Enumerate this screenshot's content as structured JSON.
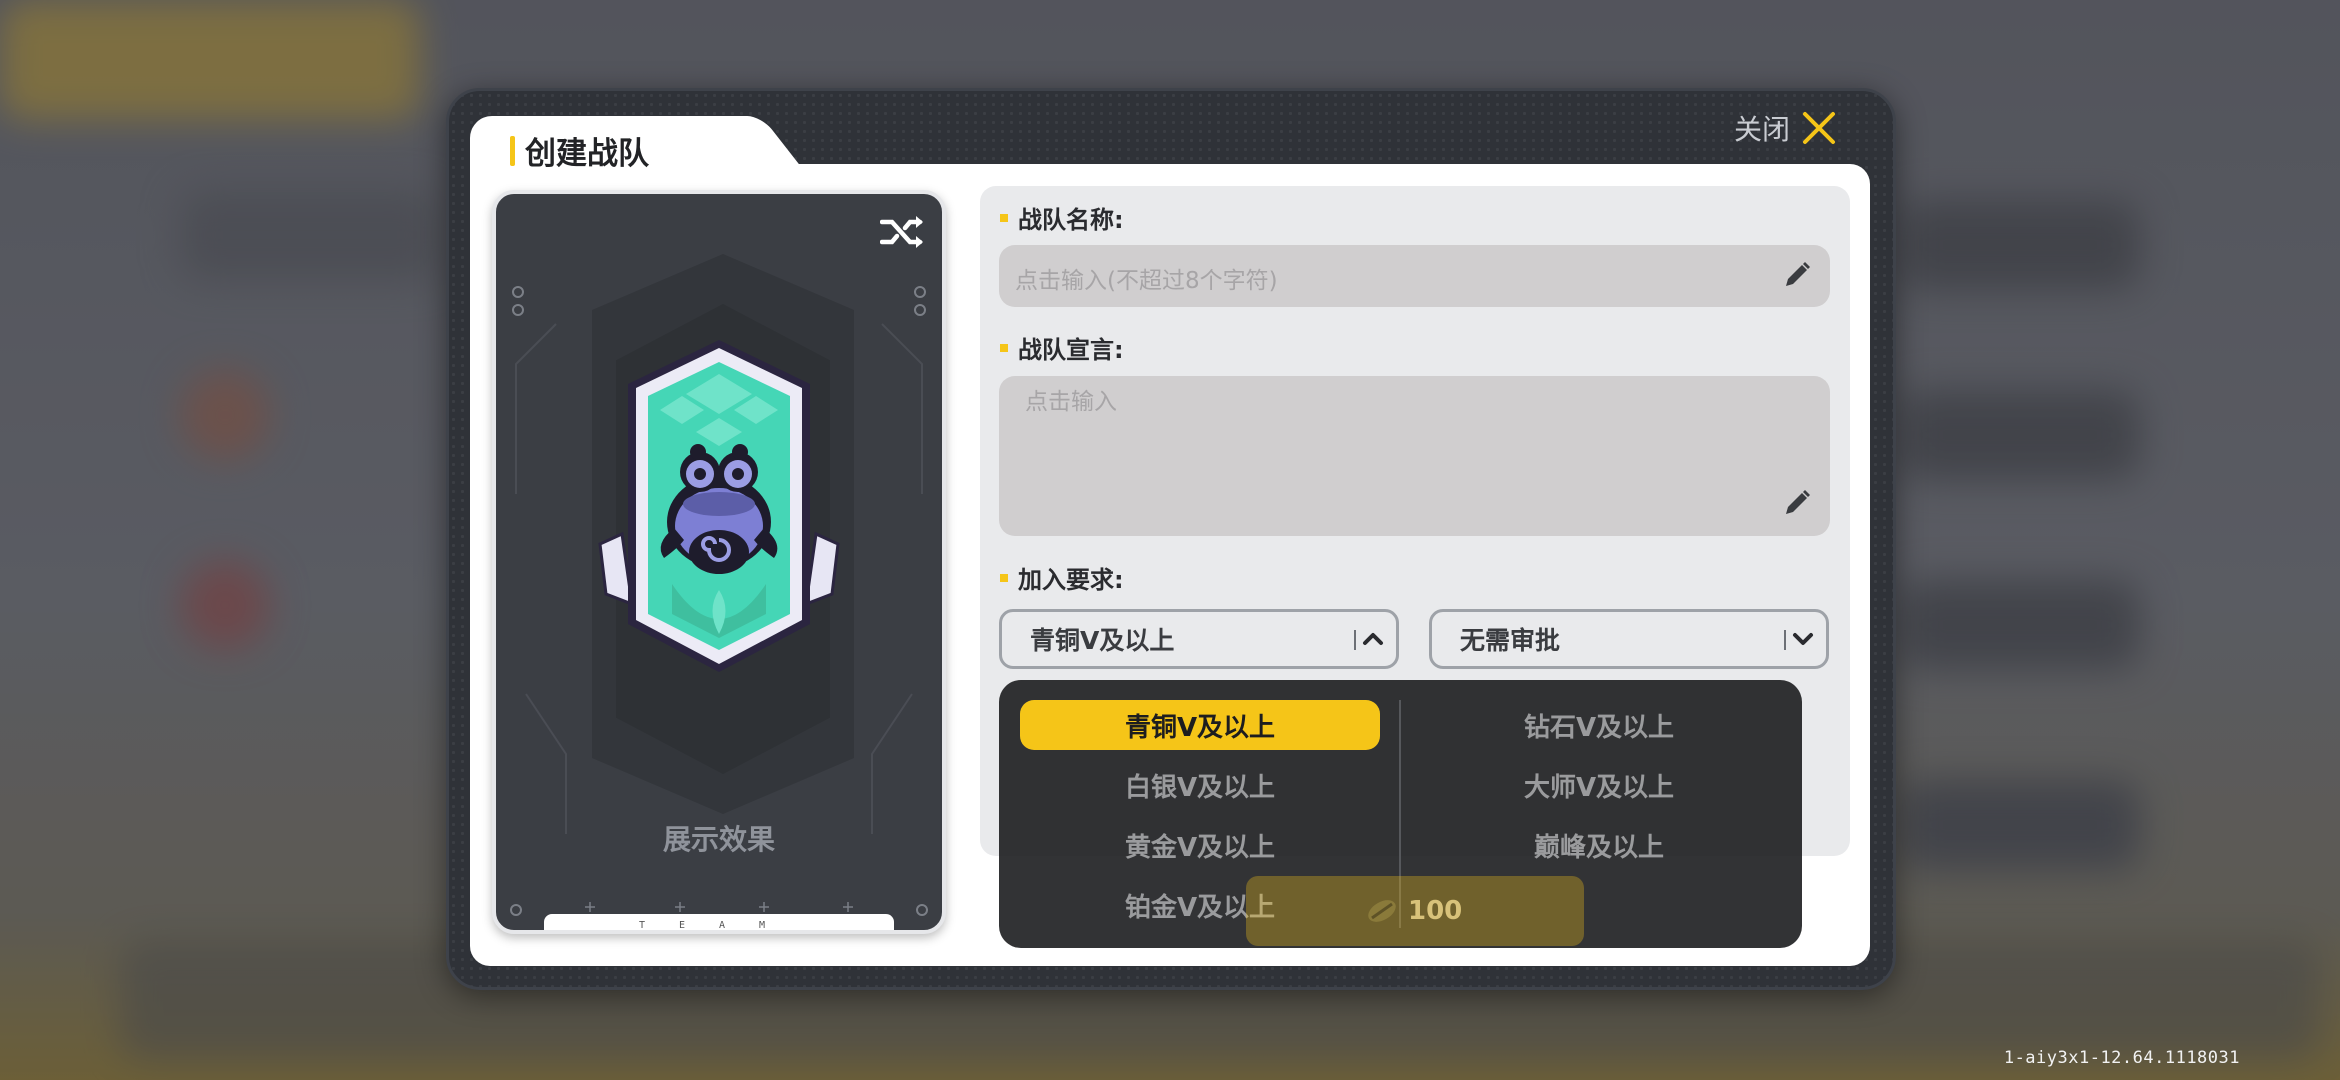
{
  "dialog": {
    "title": "创建战队",
    "close_label": "关闭"
  },
  "preview": {
    "label": "展示效果",
    "footer_text": "TEAM",
    "emblem": {
      "name": "frog-mascot-emblem",
      "colors": {
        "teal": "#45d6b6",
        "purple": "#7d7fd4",
        "dark": "#1e1c2c"
      }
    }
  },
  "form": {
    "team_name": {
      "label": "战队名称:",
      "placeholder": "点击输入(不超过8个字符)"
    },
    "declaration": {
      "label": "战队宣言:",
      "placeholder": "点击输入"
    },
    "join_requirement": {
      "label": "加入要求:",
      "rank_select": {
        "value": "青铜V及以上",
        "state": "open"
      },
      "approval_select": {
        "value": "无需审批",
        "state": "closed"
      }
    }
  },
  "rank_options": {
    "left": [
      "青铜V及以上",
      "白银V及以上",
      "黄金V及以上",
      "铂金V及以上"
    ],
    "right": [
      "钻石V及以上",
      "大师V及以上",
      "巅峰及以上"
    ],
    "selected": "青铜V及以上"
  },
  "cost": {
    "icon": "currency-icon",
    "amount": "100"
  },
  "build_id": "1-aiy3x1-12.64.1118031",
  "colors": {
    "accent": "#f5c518",
    "frame": "#2f3238",
    "card": "#3b3e44"
  }
}
